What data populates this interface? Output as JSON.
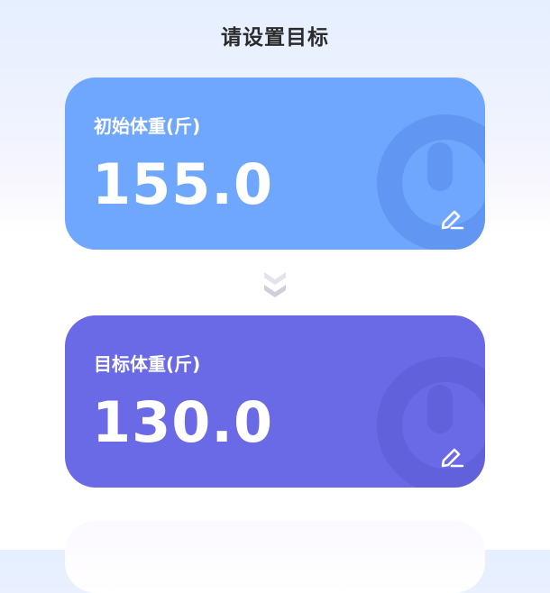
{
  "page": {
    "title": "请设置目标"
  },
  "start_card": {
    "label": "初始体重(斤)",
    "value": "155.0"
  },
  "target_card": {
    "label": "目标体重(斤)",
    "value": "130.0"
  },
  "colors": {
    "start_card_bg": "#70a7fe",
    "target_card_bg": "#6a6ae6"
  },
  "icons": {
    "edit": "pencil-edit-icon",
    "arrow": "double-chevron-down-icon",
    "decoration": "scale-weight-icon"
  }
}
